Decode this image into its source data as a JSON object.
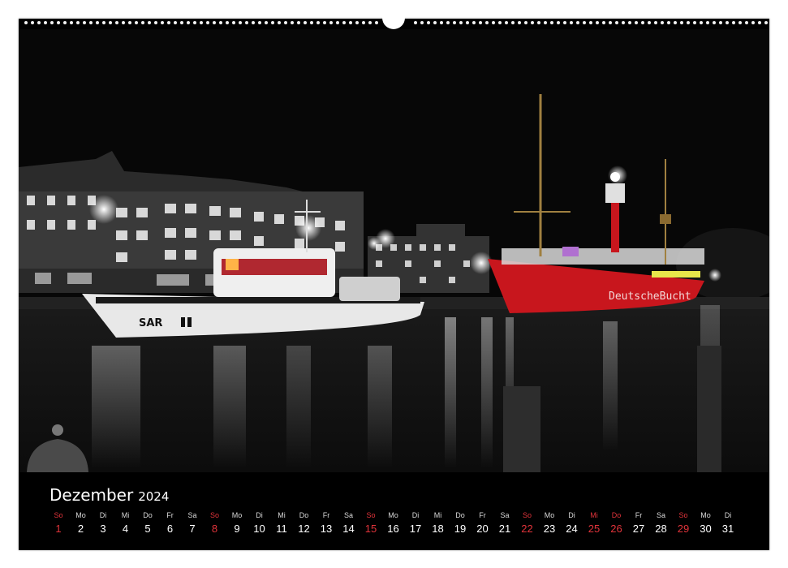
{
  "calendar": {
    "month": "Dezember",
    "year": "2024",
    "days": [
      {
        "wd": "So",
        "d": "1",
        "red": true
      },
      {
        "wd": "Mo",
        "d": "2",
        "red": false
      },
      {
        "wd": "Di",
        "d": "3",
        "red": false
      },
      {
        "wd": "Mi",
        "d": "4",
        "red": false
      },
      {
        "wd": "Do",
        "d": "5",
        "red": false
      },
      {
        "wd": "Fr",
        "d": "6",
        "red": false
      },
      {
        "wd": "Sa",
        "d": "7",
        "red": false
      },
      {
        "wd": "So",
        "d": "8",
        "red": true
      },
      {
        "wd": "Mo",
        "d": "9",
        "red": false
      },
      {
        "wd": "Di",
        "d": "10",
        "red": false
      },
      {
        "wd": "Mi",
        "d": "11",
        "red": false
      },
      {
        "wd": "Do",
        "d": "12",
        "red": false
      },
      {
        "wd": "Fr",
        "d": "13",
        "red": false
      },
      {
        "wd": "Sa",
        "d": "14",
        "red": false
      },
      {
        "wd": "So",
        "d": "15",
        "red": true
      },
      {
        "wd": "Mo",
        "d": "16",
        "red": false
      },
      {
        "wd": "Di",
        "d": "17",
        "red": false
      },
      {
        "wd": "Mi",
        "d": "18",
        "red": false
      },
      {
        "wd": "Do",
        "d": "19",
        "red": false
      },
      {
        "wd": "Fr",
        "d": "20",
        "red": false
      },
      {
        "wd": "Sa",
        "d": "21",
        "red": false
      },
      {
        "wd": "So",
        "d": "22",
        "red": true
      },
      {
        "wd": "Mo",
        "d": "23",
        "red": false
      },
      {
        "wd": "Di",
        "d": "24",
        "red": false
      },
      {
        "wd": "Mi",
        "d": "25",
        "red": true
      },
      {
        "wd": "Do",
        "d": "26",
        "red": true
      },
      {
        "wd": "Fr",
        "d": "27",
        "red": false
      },
      {
        "wd": "Sa",
        "d": "28",
        "red": false
      },
      {
        "wd": "So",
        "d": "29",
        "red": true
      },
      {
        "wd": "Mo",
        "d": "30",
        "red": false
      },
      {
        "wd": "Di",
        "d": "31",
        "red": false
      }
    ]
  },
  "photo": {
    "ship_left_text": "SAR",
    "ship_right_text": "DeutscheBucht"
  },
  "colors": {
    "holiday_red": "#e0333a",
    "lightship_red": "#c8161d"
  }
}
